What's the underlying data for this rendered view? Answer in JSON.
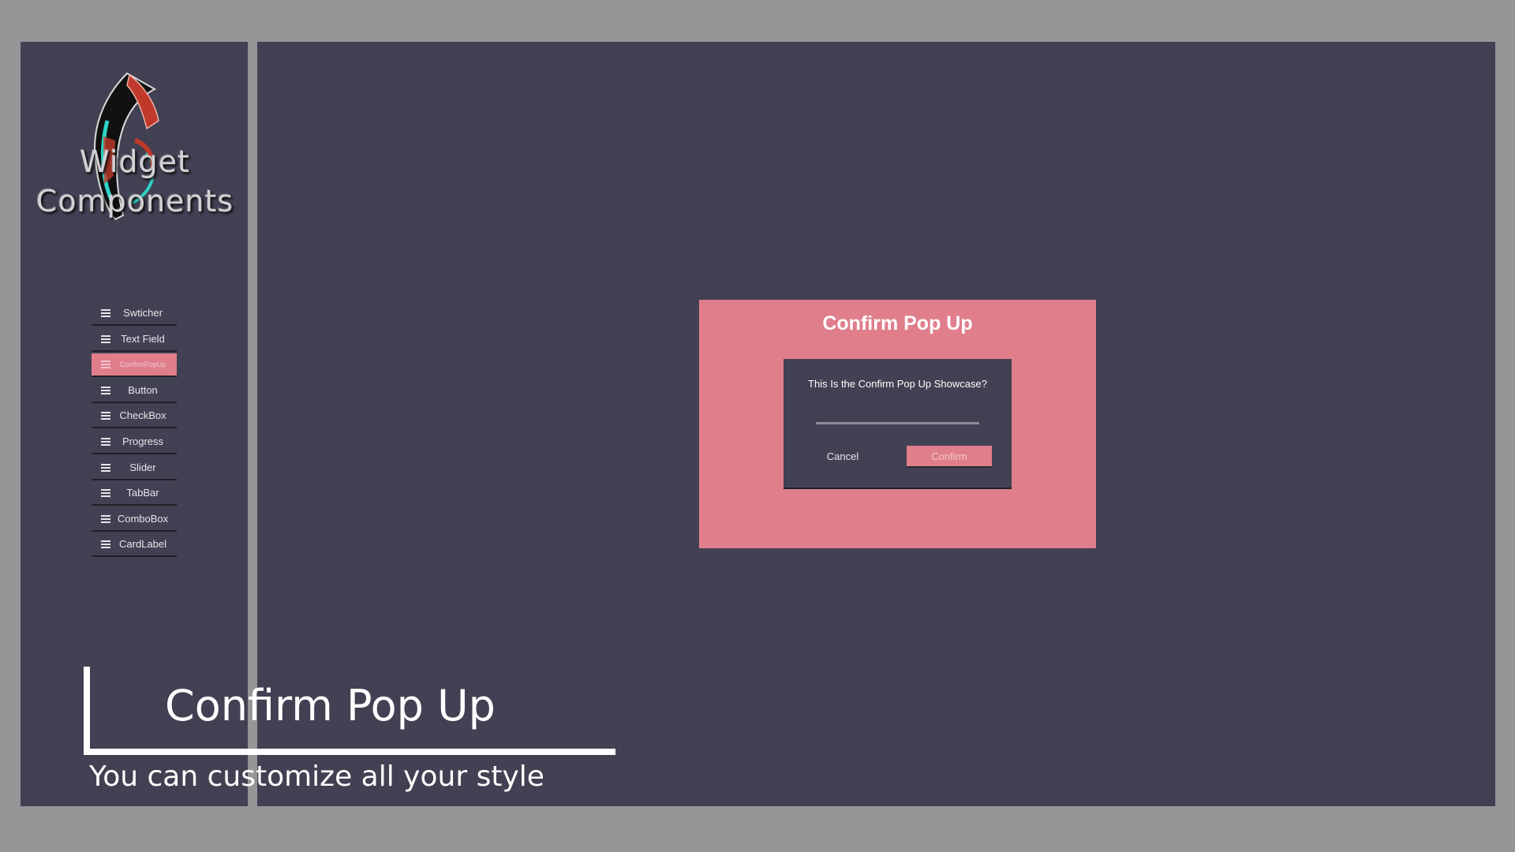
{
  "logo": {
    "line1": "Widget",
    "line2": "Components"
  },
  "menu": {
    "items": [
      {
        "label": "Swticher",
        "active": false
      },
      {
        "label": "Text Field",
        "active": false
      },
      {
        "label": "ConfirmPopUp",
        "active": true
      },
      {
        "label": "Button",
        "active": false
      },
      {
        "label": "CheckBox",
        "active": false
      },
      {
        "label": "Progress",
        "active": false
      },
      {
        "label": "Slider",
        "active": false
      },
      {
        "label": "TabBar",
        "active": false
      },
      {
        "label": "ComboBox",
        "active": false
      },
      {
        "label": "CardLabel",
        "active": false
      }
    ]
  },
  "showcase": {
    "title": "Confirm Pop Up",
    "popup": {
      "message": "This Is the Confirm Pop Up Showcase?",
      "cancel_label": "Cancel",
      "confirm_label": "Confirm"
    }
  },
  "caption": {
    "title": "Confirm Pop Up",
    "subtitle": "You can customize all your style"
  },
  "colors": {
    "background": "#969699",
    "panel": "#414153",
    "accent": "#e07e8c",
    "text": "#ffffff"
  },
  "icons": {
    "menu_item": "hamburger-icon",
    "logo": "logo-emblem"
  }
}
